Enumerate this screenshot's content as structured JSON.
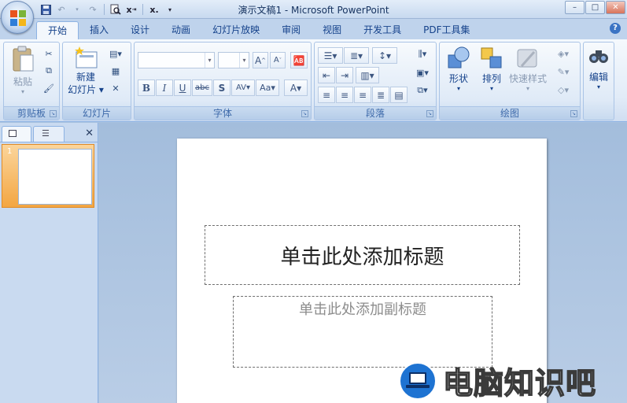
{
  "window": {
    "title": "演示文稿1 - Microsoft PowerPoint",
    "controls": {
      "minimize": "–",
      "maximize": "□",
      "close": "✕"
    }
  },
  "qat": {
    "undo": "↶",
    "redo": "↷"
  },
  "tabs": [
    {
      "label": "开始",
      "active": true
    },
    {
      "label": "插入"
    },
    {
      "label": "设计"
    },
    {
      "label": "动画"
    },
    {
      "label": "幻灯片放映"
    },
    {
      "label": "审阅"
    },
    {
      "label": "视图"
    },
    {
      "label": "开发工具"
    },
    {
      "label": "PDF工具集"
    }
  ],
  "help": "?",
  "ribbon": {
    "clipboard": {
      "label": "剪贴板",
      "paste": "粘贴"
    },
    "slides": {
      "label": "幻灯片",
      "new_slide_line1": "新建",
      "new_slide_line2": "幻灯片 ▾"
    },
    "font": {
      "label": "字体",
      "bold": "B",
      "italic": "I",
      "underline": "U",
      "strike": "abc",
      "shadow": "S",
      "spacing": "AV",
      "case": "Aa",
      "grow": "A",
      "shrink": "A",
      "color": "A"
    },
    "paragraph": {
      "label": "段落"
    },
    "drawing": {
      "label": "绘图",
      "shapes": "形状",
      "arrange": "排列",
      "quick_styles": "快速样式"
    },
    "editing": {
      "label": "编辑"
    }
  },
  "slide_pane": {
    "thumb_number": "1",
    "close": "✕"
  },
  "slide": {
    "title_placeholder": "单击此处添加标题",
    "subtitle_placeholder": "单击此处添加副标题"
  },
  "watermark": {
    "text": "电脑知识吧"
  },
  "colors": {
    "accent": "#15428b",
    "selected_thumb": "#f3a642",
    "ribbon_bg": "#dfeaf7"
  }
}
